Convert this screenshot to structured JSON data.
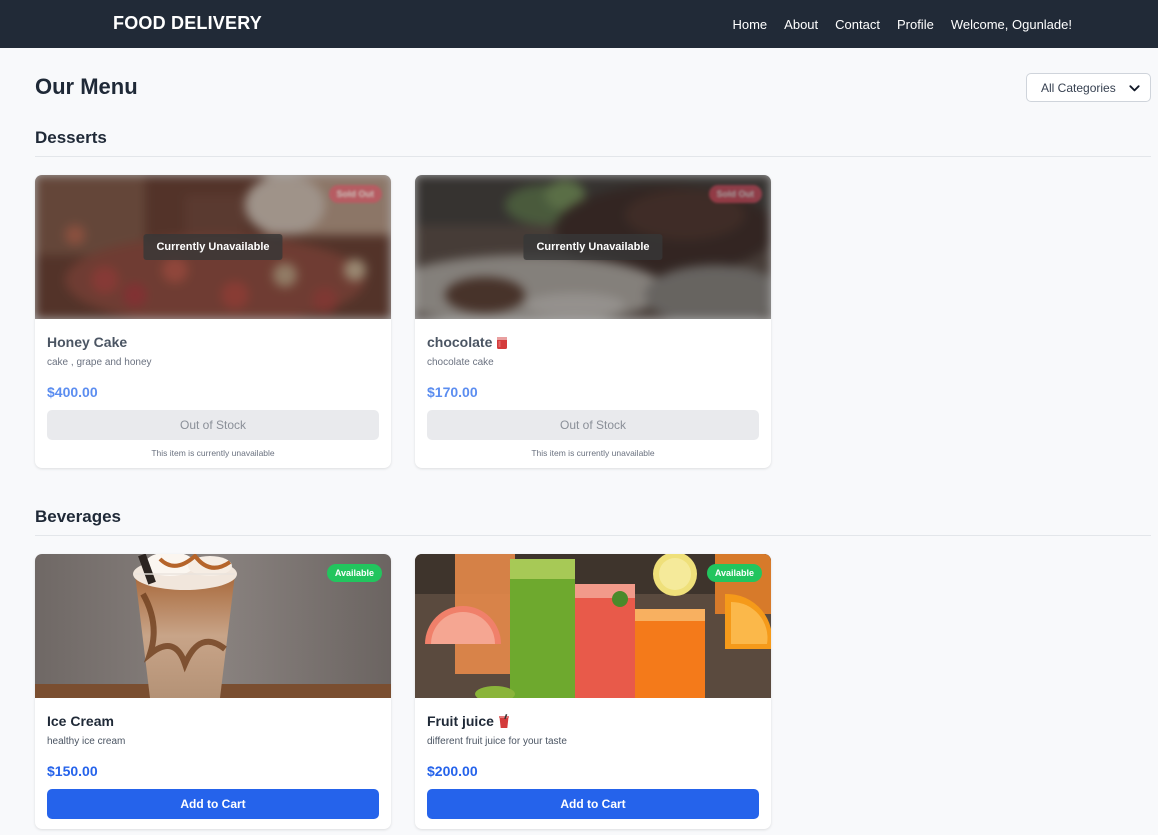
{
  "navbar": {
    "brand": "FOOD DELIVERY",
    "links": [
      "Home",
      "About",
      "Contact",
      "Profile"
    ],
    "welcome": "Welcome, Ogunlade!"
  },
  "menu": {
    "title": "Our Menu",
    "category_filter": {
      "selected": "All Categories",
      "icon": "chevron-down-icon"
    }
  },
  "sections": [
    {
      "title": "Desserts",
      "items": [
        {
          "name": "Honey Cake",
          "description": "cake , grape and honey",
          "price": "$400.00",
          "overlay": "Currently Unavailable",
          "badge": "Sold Out",
          "button": "Out of Stock",
          "note": "This item is currently unavailable"
        },
        {
          "name": "chocolate",
          "name_icon": "glass-icon",
          "description": "chocolate cake",
          "price": "$170.00",
          "overlay": "Currently Unavailable",
          "badge": "Sold Out",
          "button": "Out of Stock",
          "note": "This item is currently unavailable"
        }
      ]
    },
    {
      "title": "Beverages",
      "items": [
        {
          "name": "Ice Cream",
          "description": "healthy ice cream",
          "price": "$150.00",
          "badge": "Available",
          "button": "Add to Cart"
        },
        {
          "name": "Fruit juice",
          "name_icon": "cup-icon",
          "description": "different fruit juice for your taste",
          "price": "$200.00",
          "badge": "Available",
          "button": "Add to Cart"
        }
      ]
    }
  ],
  "colors": {
    "navbar_bg": "#212a37",
    "primary": "#2563eb",
    "available": "#22c55e",
    "sold_out": "#d9485f"
  }
}
